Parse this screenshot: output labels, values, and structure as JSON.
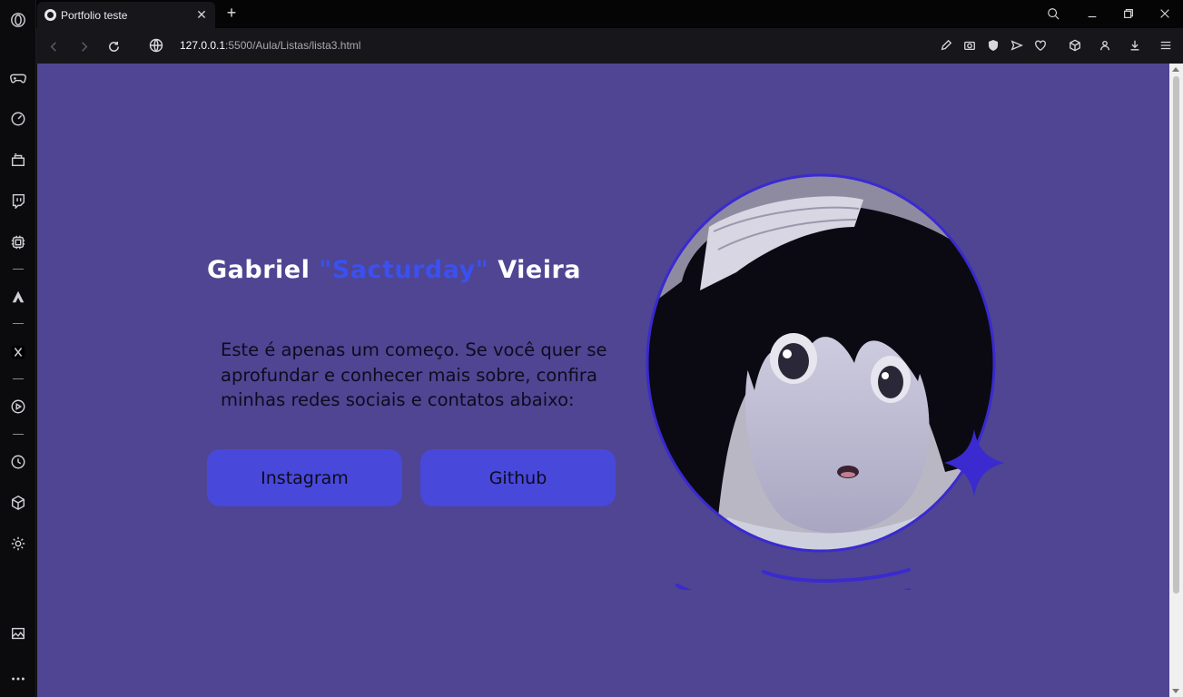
{
  "browser": {
    "tab_title": "Portfolio teste",
    "url_host": "127.0.0.1",
    "url_path": ":5500/Aula/Listas/lista3.html"
  },
  "page": {
    "name_first": "Gabriel ",
    "name_nick": "\"Sacturday\"",
    "name_last": " Vieira",
    "intro": "Este é apenas um começo. Se você quer se aprofundar e conhecer mais sobre, confira minhas redes sociais e contatos abaixo:",
    "buttons": {
      "instagram": "Instagram",
      "github": "Github"
    }
  },
  "colors": {
    "page_bg": "#4f4592",
    "accent_nick": "#3a50f0",
    "button_bg": "#4848da",
    "ring": "#3a2ad0"
  },
  "icons": {
    "sidebar": [
      "opera-logo-icon",
      "gamepad-icon",
      "speed-dial-icon",
      "bag-icon",
      "twitch-icon",
      "chip-icon",
      "aria-icon",
      "x-icon",
      "player-icon",
      "history-icon",
      "cube-icon",
      "settings-icon",
      "gallery-icon",
      "more-icon"
    ],
    "toolbar": [
      "edit-icon",
      "camera-icon",
      "shield-icon",
      "send-icon",
      "heart-icon",
      "cube-icon",
      "profile-icon",
      "download-icon",
      "menu-icon"
    ]
  }
}
